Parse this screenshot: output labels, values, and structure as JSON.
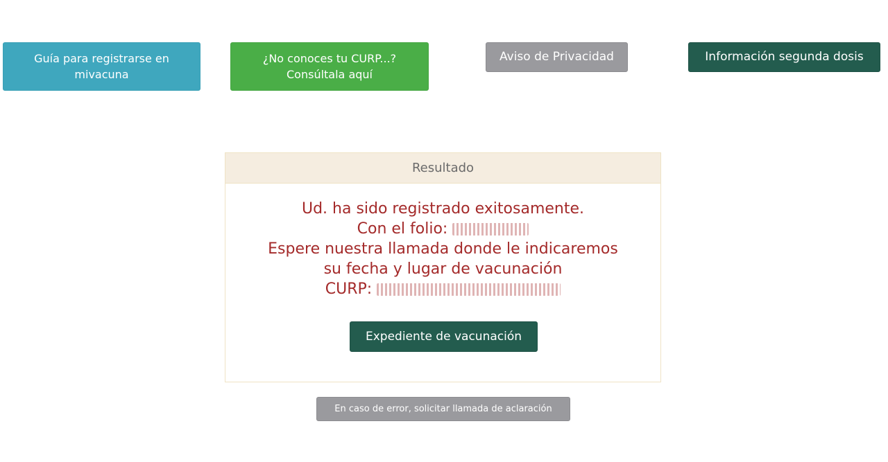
{
  "top_buttons": {
    "guide_label": "Guía para registrarse en mivacuna",
    "curp_label": "¿No conoces tu CURP...? Consúltala aquí",
    "privacy_label": "Aviso de Privacidad",
    "second_dose_label": "Información segunda dosis"
  },
  "result_panel": {
    "title": "Resultado",
    "line1": "Ud. ha sido registrado exitosamente.",
    "line2_prefix": "Con el folio:",
    "line3": "Espere nuestra llamada donde le indicaremos",
    "line4": "su fecha y lugar de vacunación",
    "line5_prefix": "CURP:",
    "expediente_label": "Expediente de vacunación"
  },
  "error_button_label": "En caso de error, solicitar llamada de aclaración",
  "colors": {
    "teal": "#3fa7be",
    "green": "#4aae47",
    "gray": "#9a9a9e",
    "dark_green": "#235c4e",
    "message_red": "#a42a2a",
    "panel_header_bg": "#f5ede0"
  }
}
